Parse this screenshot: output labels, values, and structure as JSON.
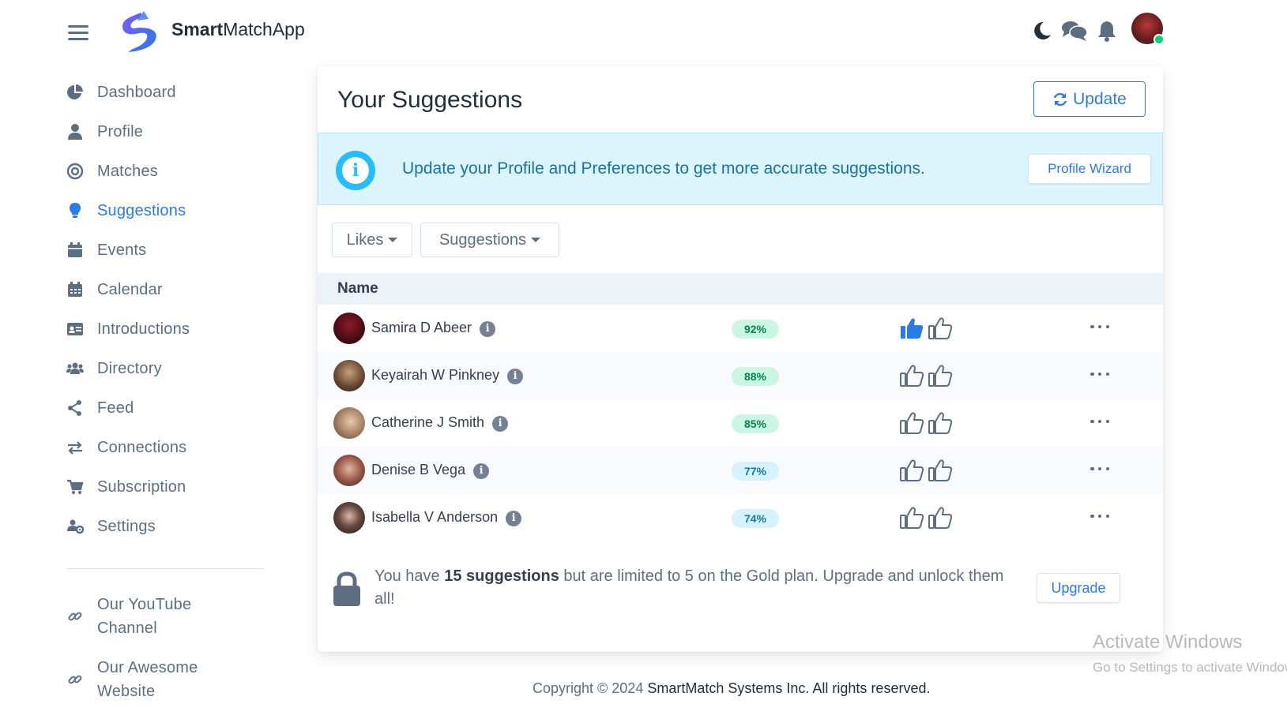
{
  "header": {
    "brand_bold": "Smart",
    "brand_rest": "MatchApp",
    "icons": [
      "menu-icon",
      "moon-icon",
      "chat-icon",
      "bell-icon",
      "avatar"
    ]
  },
  "sidebar": {
    "items": [
      {
        "label": "Dashboard",
        "icon": "pie-chart-icon"
      },
      {
        "label": "Profile",
        "icon": "user-icon"
      },
      {
        "label": "Matches",
        "icon": "target-icon"
      },
      {
        "label": "Suggestions",
        "icon": "lightbulb-icon",
        "active": true
      },
      {
        "label": "Events",
        "icon": "calendar-check-icon"
      },
      {
        "label": "Calendar",
        "icon": "calendar-icon"
      },
      {
        "label": "Introductions",
        "icon": "id-card-icon"
      },
      {
        "label": "Directory",
        "icon": "users-icon"
      },
      {
        "label": "Feed",
        "icon": "share-icon"
      },
      {
        "label": "Connections",
        "icon": "exchange-icon"
      },
      {
        "label": "Subscription",
        "icon": "cart-icon"
      },
      {
        "label": "Settings",
        "icon": "users-cog-icon"
      }
    ],
    "external": [
      {
        "label": "Our YouTube Channel",
        "icon": "link-icon"
      },
      {
        "label": "Our Awesome Website",
        "icon": "link-icon"
      }
    ]
  },
  "main": {
    "title": "Your Suggestions",
    "update_label": "Update",
    "alert": {
      "text": "Update your Profile and Preferences to get more accurate suggestions.",
      "button": "Profile Wizard"
    },
    "filters": {
      "likes": "Likes",
      "suggestions": "Suggestions"
    },
    "table_header": "Name",
    "rows": [
      {
        "name": "Samira D Abeer",
        "match": "92%",
        "liked": true
      },
      {
        "name": "Keyairah W Pinkney",
        "match": "88%",
        "liked": false
      },
      {
        "name": "Catherine J Smith",
        "match": "85%",
        "liked": false
      },
      {
        "name": "Denise B Vega",
        "match": "77%",
        "liked": false
      },
      {
        "name": "Isabella V Anderson",
        "match": "74%",
        "liked": false
      }
    ],
    "limit": {
      "prefix": "You have ",
      "bold": "15 suggestions",
      "suffix": " but are limited to 5 on the Gold plan. Upgrade and unlock them all!",
      "button": "Upgrade"
    }
  },
  "footer": {
    "prefix": "Copyright © 2024 ",
    "company": "SmartMatch Systems Inc. All rights reserved."
  },
  "watermark": {
    "line1": "Activate Windows",
    "line2": "Go to Settings to activate Windows."
  },
  "colors": {
    "primary": "#2c7be5",
    "info_bg": "#dcf5fd",
    "success_badge": "#ccf6e4",
    "info_badge": "#d5f2fe"
  }
}
